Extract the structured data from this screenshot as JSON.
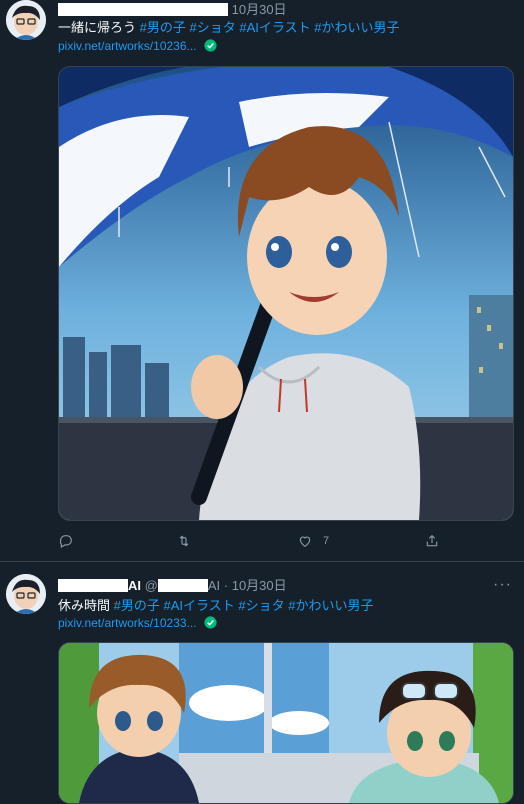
{
  "tweets": [
    {
      "date": "10月30日",
      "text": "一緒に帰ろう",
      "tags": [
        "#男の子",
        "#ショタ",
        "#AIイラスト",
        "#かわいい男子"
      ],
      "link": "pixiv.net/artworks/10236...",
      "actions": {
        "reply": "",
        "retweet": "",
        "like": "7",
        "share": ""
      }
    },
    {
      "name_suffix": "AI",
      "handle_at": "@",
      "handle_suffix": "AI",
      "separator": "·",
      "date": "10月30日",
      "text": "休み時間",
      "tags": [
        "#男の子",
        "#AIイラスト",
        "#ショタ",
        "#かわいい男子"
      ],
      "link": "pixiv.net/artworks/10233...",
      "more": "···"
    }
  ],
  "colors": {
    "background": "#15202b",
    "link": "#1d9bf0",
    "divider": "#38444d",
    "verified": "#00ba7c"
  },
  "icons": [
    "avatar",
    "verified-icon",
    "reply-icon",
    "retweet-icon",
    "like-icon",
    "share-icon",
    "more-icon"
  ]
}
